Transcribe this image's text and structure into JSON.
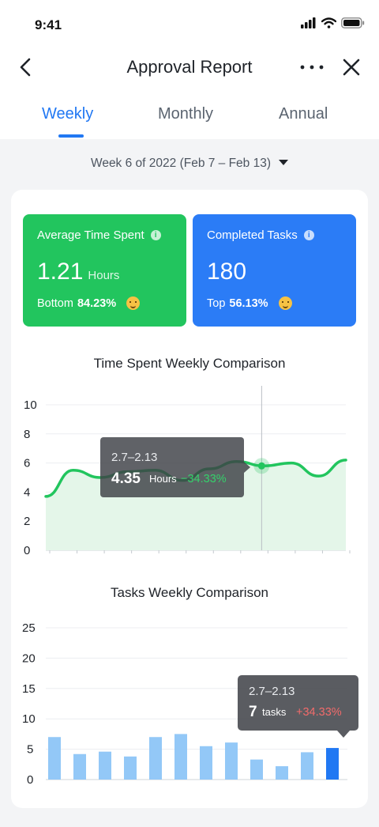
{
  "status": {
    "time": "9:41"
  },
  "nav": {
    "title": "Approval Report"
  },
  "tabs": [
    {
      "label": "Weekly",
      "active": true
    },
    {
      "label": "Monthly",
      "active": false
    },
    {
      "label": "Annual",
      "active": false
    }
  ],
  "week_selector": "Week 6 of 2022 (Feb 7 – Feb 13)",
  "kpis": {
    "time": {
      "label": "Average Time Spent",
      "value": "1.21",
      "unit": "Hours",
      "rank_prefix": "Bottom",
      "rank_value": "84.23%",
      "color": "#22c55e"
    },
    "tasks": {
      "label": "Completed Tasks",
      "value": "180",
      "rank_prefix": "Top",
      "rank_value": "56.13%",
      "color": "#2b7cf6"
    }
  },
  "line_section": {
    "title": "Time Spent Weekly Comparison"
  },
  "bar_section": {
    "title": "Tasks Weekly Comparison"
  },
  "colors": {
    "accent": "#2178f3",
    "green": "#22c55e",
    "bar": "#93c8f7",
    "bar_highlight": "#2178f3",
    "negative": "#f26b6b"
  },
  "chart_data": [
    {
      "type": "area",
      "title": "Time Spent Weekly Comparison",
      "ylim": [
        0,
        10
      ],
      "yticks": [
        0,
        2,
        4,
        6,
        8,
        10
      ],
      "x": [
        0,
        1,
        2,
        3,
        4,
        5,
        6,
        7,
        8,
        9,
        10,
        11
      ],
      "values": [
        3.7,
        5.5,
        5.0,
        5.4,
        5.5,
        4.8,
        5.6,
        6.1,
        5.8,
        6.0,
        5.1,
        6.2
      ],
      "highlight_index": 8,
      "grid": true,
      "tooltip": {
        "period": "2.7–2.13",
        "value": "4.35",
        "unit": "Hours",
        "change": "−34.33%"
      }
    },
    {
      "type": "bar",
      "title": "Tasks Weekly Comparison",
      "ylim": [
        0,
        25
      ],
      "yticks": [
        0,
        5,
        10,
        15,
        20,
        25
      ],
      "values": [
        7,
        4.2,
        4.6,
        3.8,
        7,
        7.5,
        5.5,
        6.1,
        3.3,
        2.2,
        4.5,
        5.2
      ],
      "highlight_index": 11,
      "grid": true,
      "tooltip": {
        "period": "2.7–2.13",
        "value": "7",
        "unit": "tasks",
        "change": "+34.33%"
      }
    }
  ]
}
